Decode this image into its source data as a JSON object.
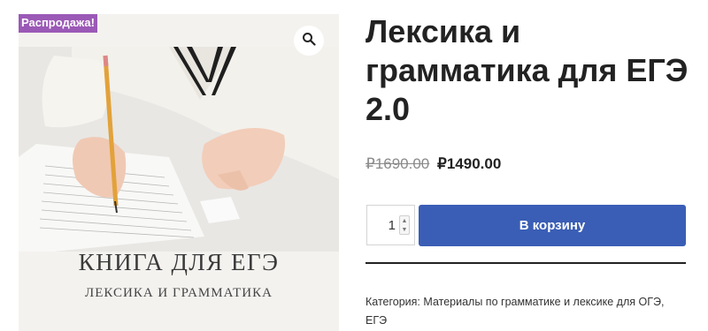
{
  "badge": {
    "sale": "Распродажа!"
  },
  "gallery": {
    "zoom_icon": "magnifier-icon",
    "book_title": "КНИГА ДЛЯ ЕГЭ",
    "book_subtitle": "ЛЕКСИКА И ГРАММАТИКА"
  },
  "product": {
    "title": "Лексика и грамматика для ЕГЭ 2.0",
    "old_price": "₽1690.00",
    "new_price": "₽1490.00"
  },
  "cart": {
    "quantity": "1",
    "button_label": "В корзину",
    "button_color": "#3a5eb5"
  },
  "meta": {
    "category_label": "Категория:",
    "category_value": "Материалы по грамматике и лексике для ОГЭ, ЕГЭ"
  },
  "colors": {
    "sale_badge": "#9b59b6",
    "title": "#222222",
    "old_price": "#8a8a8a"
  }
}
